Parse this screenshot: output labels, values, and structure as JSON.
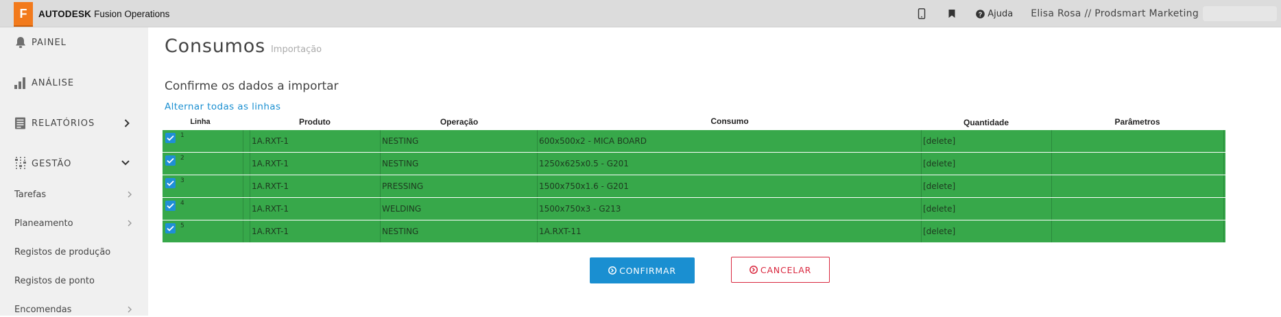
{
  "topbar": {
    "logo_letter": "F",
    "brand": "AUTODESK",
    "product": "Fusion Operations",
    "help_label": "Ajuda",
    "user": "Elisa Rosa // Prodsmart Marketing"
  },
  "sidebar": {
    "main_items": [
      {
        "label": "PAINEL",
        "icon": "bell-icon"
      },
      {
        "label": "ANÁLISE",
        "icon": "bar-chart-icon"
      },
      {
        "label": "RELATÓRIOS",
        "icon": "report-icon",
        "chevron": "right"
      },
      {
        "label": "GESTÃO",
        "icon": "sliders-icon",
        "chevron": "down",
        "expanded": true
      }
    ],
    "sub_items": [
      {
        "label": "Tarefas",
        "chevron": true
      },
      {
        "label": "Planeamento",
        "chevron": true
      },
      {
        "label": "Registos de produção",
        "chevron": false
      },
      {
        "label": "Registos de ponto",
        "chevron": false
      },
      {
        "label": "Encomendas",
        "chevron": true
      }
    ]
  },
  "page": {
    "title": "Consumos",
    "title_suffix": "Importação",
    "subtitle": "Confirme os dados a importar",
    "toggle_all": "Alternar todas as linhas"
  },
  "table": {
    "headers": {
      "linha": "Linha",
      "produto": "Produto",
      "operacao": "Operação",
      "consumo": "Consumo",
      "quantidade": "Quantidade",
      "parametros": "Parâmetros"
    },
    "row_color": "#37a84a",
    "rows": [
      {
        "linha": "1",
        "checked": true,
        "produto": "1A.RXT-1",
        "operacao": "NESTING",
        "consumo": "600x500x2 - MICA BOARD",
        "quantidade": "[delete]",
        "parametros": ""
      },
      {
        "linha": "2",
        "checked": true,
        "produto": "1A.RXT-1",
        "operacao": "NESTING",
        "consumo": "1250x625x0.5 - G201",
        "quantidade": "[delete]",
        "parametros": ""
      },
      {
        "linha": "3",
        "checked": true,
        "produto": "1A.RXT-1",
        "operacao": "PRESSING",
        "consumo": "1500x750x1.6 - G201",
        "quantidade": "[delete]",
        "parametros": ""
      },
      {
        "linha": "4",
        "checked": true,
        "produto": "1A.RXT-1",
        "operacao": "WELDING",
        "consumo": "1500x750x3 - G213",
        "quantidade": "[delete]",
        "parametros": ""
      },
      {
        "linha": "5",
        "checked": true,
        "produto": "1A.RXT-1",
        "operacao": "NESTING",
        "consumo": "1A.RXT-11",
        "quantidade": "[delete]",
        "parametros": ""
      }
    ]
  },
  "actions": {
    "confirm_label": "CONFIRMAR",
    "cancel_label": "CANCELAR",
    "confirm_color": "#1a8fd1",
    "cancel_color": "#d9263d"
  }
}
